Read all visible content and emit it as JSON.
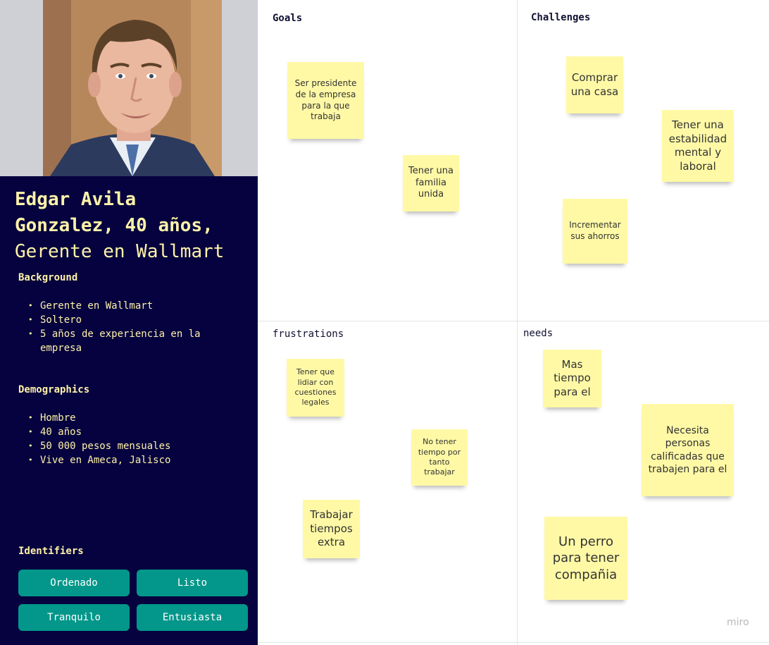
{
  "persona": {
    "name_line1": "Edgar Avila",
    "name_line2": "Gonzalez, 40 años,",
    "role": "Gerente en Wallmart",
    "background": {
      "title": "Background",
      "items": [
        "Gerente en Wallmart",
        "Soltero",
        "5 años de experiencia en la empresa"
      ]
    },
    "demographics": {
      "title": "Demographics",
      "items": [
        "Hombre",
        "40 años",
        "50 000 pesos mensuales",
        "Vive en Ameca, Jalisco"
      ]
    },
    "identifiers": {
      "title": "Identifiers",
      "tags": [
        "Ordenado",
        "Listo",
        "Tranquilo",
        "Entusiasta"
      ]
    }
  },
  "board": {
    "goals": {
      "title": "Goals",
      "notes": [
        "Ser presidente de la empresa para la que trabaja",
        "Tener una familia unida"
      ]
    },
    "challenges": {
      "title": "Challenges",
      "notes": [
        "Comprar una casa",
        "Tener una estabilidad mental y laboral",
        "Incrementar sus ahorros"
      ]
    },
    "frustrations": {
      "title": "frustrations",
      "notes": [
        "Tener que lidiar con cuestiones legales",
        "No tener tiempo por tanto trabajar",
        "Trabajar tiempos extra"
      ]
    },
    "needs": {
      "title": "needs",
      "notes": [
        "Mas tiempo para el",
        "Necesita personas calificadas que trabajen para el",
        "Un perro para tener compañia"
      ]
    }
  },
  "brand": "miro",
  "colors": {
    "panel": "#05023f",
    "accent_text": "#fff2a8",
    "tag": "#02978a",
    "sticky": "#fff9a6"
  }
}
